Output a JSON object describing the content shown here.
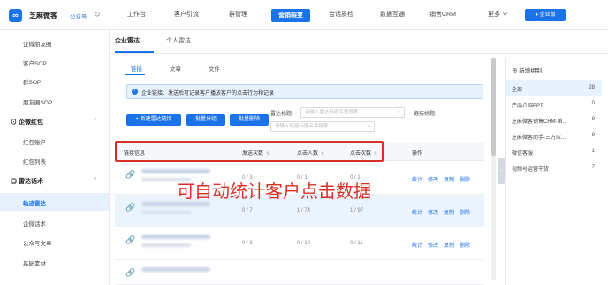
{
  "header": {
    "logo_char": "∞",
    "brand": "芝麻微客",
    "account_label": "公众号",
    "nav": [
      "工作台",
      "客户引流",
      "群管理",
      "营销裂变",
      "会话质检",
      "数据互通",
      "销售CRM",
      "更多 ∨"
    ],
    "active_nav": "营销裂变",
    "enterprise_button": "● 企业版"
  },
  "sidebar": {
    "items_top": [
      "企微朋友圈",
      "客户SOP",
      "群SOP",
      "朋友圈SOP"
    ],
    "group1": "企微红包",
    "group1_items": [
      "红包账户",
      "红包列表"
    ],
    "group2": "雷达话术",
    "active_item": "轨迹雷达",
    "group2_items": [
      "企微话术",
      "公众号文章",
      "基础素材"
    ]
  },
  "content": {
    "tabs": [
      "企业雷达",
      "个人雷达"
    ],
    "subtabs": [
      "链接",
      "文章",
      "文件"
    ],
    "notice": "企业链接、发送后可记录客户播放客户的点击行为和记录",
    "buttons": {
      "new": "+ 新建雷达链接",
      "batch_group": "批量分组",
      "batch_delete": "批量删除"
    },
    "radar_title_label": "雷达标题:",
    "radar_title_placeholder": "请输入雷达标题名称搜索",
    "link_title_label": "链接标题:",
    "link_title_placeholder": "请输入链接标题名称搜索",
    "table": {
      "headers": [
        "链接信息",
        "发送次数",
        "点击人数",
        "点击次数",
        "操作"
      ],
      "rows": [
        {
          "send": "0 / 3",
          "people": "0 / 1",
          "clicks": "0 / 1"
        },
        {
          "send": "0 / 7",
          "people": "1 / 74",
          "clicks": "1 / 97"
        },
        {
          "send": "0 / 3",
          "people": "0 / 10",
          "clicks": "0 / 11"
        }
      ],
      "ops": [
        "统计",
        "修改",
        "复制",
        "删除"
      ]
    },
    "overlay": "可自动统计客户点击数据"
  },
  "right_panel": {
    "add_group": "⊕ 新增组别",
    "groups": [
      {
        "name": "全部",
        "count": "28"
      },
      {
        "name": "产品介绍PPT",
        "count": "0"
      },
      {
        "name": "芝麻微客销售CRM-第...",
        "count": "9"
      },
      {
        "name": "芝麻微客助手-三方应...",
        "count": "9"
      },
      {
        "name": "微信客服",
        "count": "1"
      },
      {
        "name": "视频号运营干货",
        "count": "7"
      }
    ]
  },
  "colors": {
    "primary": "#1a73e8",
    "highlight": "#d93025"
  }
}
